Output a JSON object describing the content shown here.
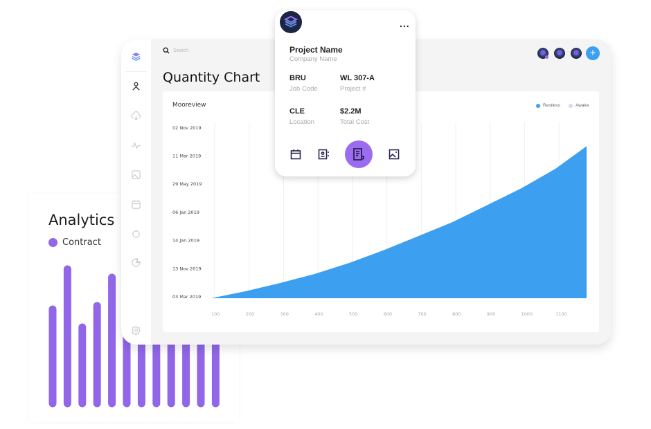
{
  "analytics": {
    "title": "Analytics",
    "legend": "Contract",
    "color": "#9166e8",
    "bars": [
      142,
      200,
      116,
      147,
      188,
      null,
      null,
      null,
      null,
      null,
      null,
      null
    ],
    "note_hidden": "bars 6-12 continue behind the dashboard panel"
  },
  "dashboard": {
    "search_placeholder": "Search",
    "title": "Quantity Chart",
    "sidebar_icons": [
      "logo-icon",
      "user-icon",
      "cloud-upload-icon",
      "activity-icon",
      "image-icon",
      "calendar-icon",
      "timer-icon",
      "pie-chart-icon",
      "settings-icon"
    ],
    "header_avatars": 3,
    "add_button": "+"
  },
  "chart_data": {
    "type": "area",
    "title": "Mooreview",
    "legend": [
      {
        "name": "Restless",
        "color": "#3d9ff0"
      },
      {
        "name": "Awake",
        "color": "#dcd3f8"
      }
    ],
    "legend_placement": "top-right",
    "x_ticks": [
      "100",
      "200",
      "300",
      "400",
      "500",
      "600",
      "700",
      "800",
      "900",
      "1000",
      "1100"
    ],
    "y_ticks": [
      "02 Nov 2019",
      "11 Mar 2019",
      "29 May 2019",
      "06 Jan 2019",
      "14 Jan 2019",
      "13 Nov 2019",
      "03 Mar 2019"
    ],
    "xlim": [
      100,
      1190
    ],
    "series": [
      {
        "name": "Restless",
        "x": [
          100,
          200,
          300,
          400,
          500,
          600,
          700,
          800,
          900,
          1000,
          1100,
          1190
        ],
        "y_level": [
          0,
          0.25,
          0.54,
          0.86,
          1.25,
          1.7,
          2.2,
          2.7,
          3.3,
          3.9,
          4.6,
          5.4
        ]
      }
    ],
    "grid": "vertical"
  },
  "popup": {
    "project": "Project Name",
    "company": "Company Name",
    "fields": [
      {
        "value": "BRU",
        "label": "Job Code"
      },
      {
        "value": "WL 307-A",
        "label": "Project #"
      },
      {
        "value": "CLE",
        "label": "Location"
      },
      {
        "value": "$2.2M",
        "label": "Total Cost"
      }
    ],
    "menu": "...",
    "actions": [
      "calendar-icon",
      "contacts-icon",
      "document-icon",
      "image-icon"
    ],
    "accent": "#9b6cf0"
  }
}
